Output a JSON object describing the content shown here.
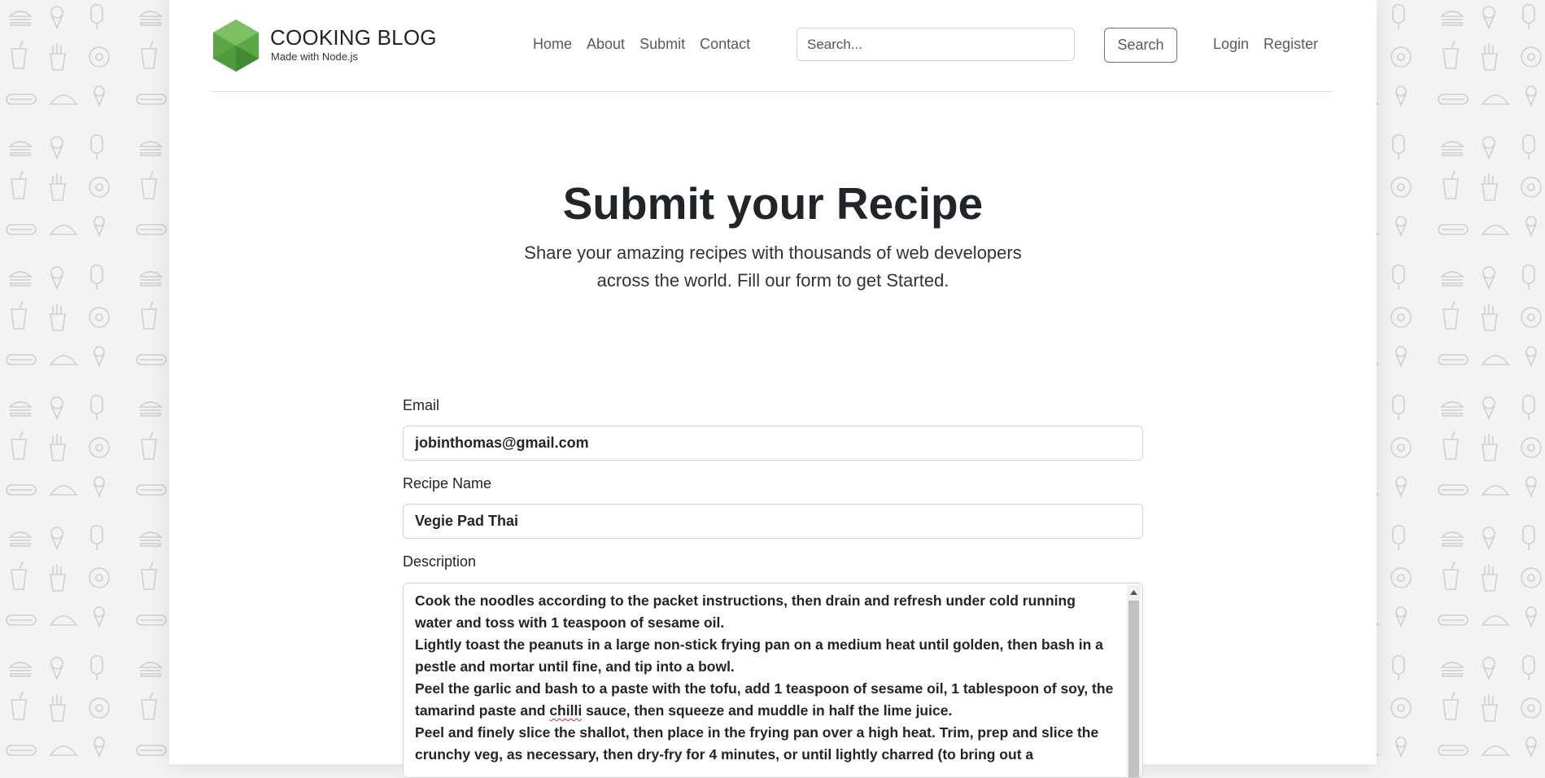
{
  "colors": {
    "accent_green": "#5ba745",
    "text_dark": "#212529",
    "nav_gray": "#555b62",
    "background": "#f3f3f3"
  },
  "header": {
    "brand_title": "COOKING BLOG",
    "brand_subtitle": "Made with Node.js",
    "logo_icon": "nodejs-hexagon-logo",
    "nav": [
      {
        "label": "Home"
      },
      {
        "label": "About"
      },
      {
        "label": "Submit"
      },
      {
        "label": "Contact"
      }
    ],
    "search": {
      "placeholder": "Search...",
      "button_label": "Search"
    },
    "auth": {
      "login_label": "Login",
      "register_label": "Register"
    }
  },
  "hero": {
    "title": "Submit your Recipe",
    "lead": "Share your amazing recipes with thousands of web developers across the world. Fill our form to get Started."
  },
  "form": {
    "email": {
      "label": "Email",
      "value": "jobinthomas@gmail.com"
    },
    "recipe_name": {
      "label": "Recipe Name",
      "value": "Vegie Pad Thai"
    },
    "description": {
      "label": "Description",
      "paragraphs": [
        "Cook the noodles according to the packet instructions, then drain and refresh under cold running water and toss with 1 teaspoon of sesame oil.",
        "Lightly toast the peanuts in a large non-stick frying pan on a medium heat until golden, then bash in a pestle and mortar until fine, and tip into a bowl."
      ],
      "p3_before": "Peel the garlic and bash to a paste with the tofu, add 1 teaspoon of sesame oil, 1 tablespoon of soy, the tamarind paste and ",
      "p3_misspelled": "chilli",
      "p3_after": " sauce, then squeeze and muddle in half the lime juice.",
      "p4": "Peel and finely slice the shallot, then place in the frying pan over a high heat. Trim, prep and slice the crunchy veg, as necessary, then dry-fry for 4 minutes, or until lightly charred (to bring out a"
    }
  }
}
